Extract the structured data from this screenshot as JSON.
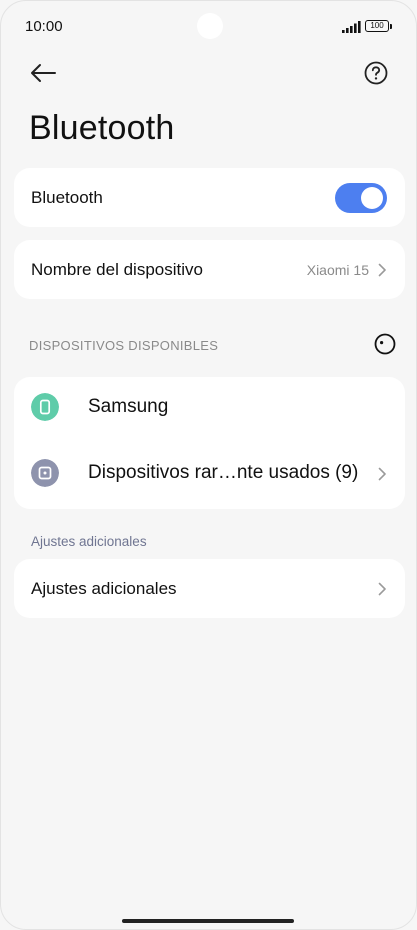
{
  "status_bar": {
    "time": "10:00",
    "battery": "100"
  },
  "header": {
    "title": "Bluetooth"
  },
  "bluetooth_card": {
    "label": "Bluetooth",
    "enabled": true
  },
  "device_name_card": {
    "label": "Nombre del dispositivo",
    "value": "Xiaomi 15"
  },
  "available_devices": {
    "header": "DISPOSITIVOS DISPONIBLES",
    "items": [
      {
        "label": "Samsung",
        "icon": "phone-icon",
        "color": "#5fcca9"
      },
      {
        "label": "Dispositivos rar…nte usados (9)",
        "icon": "device-icon",
        "color": "#8e93ad"
      }
    ]
  },
  "additional": {
    "header": "Ajustes adicionales",
    "item_label": "Ajustes adicionales"
  },
  "colors": {
    "accent": "#4d7ff0",
    "background": "#f6f6f6",
    "card": "#ffffff",
    "secondary_text": "#8a8a8a"
  }
}
